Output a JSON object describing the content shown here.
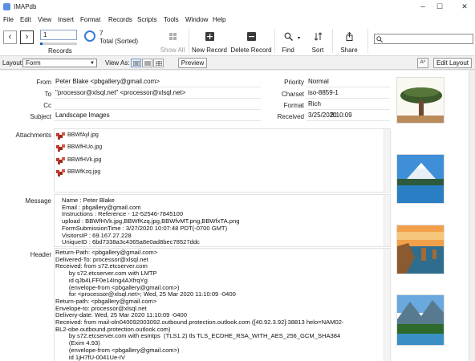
{
  "window": {
    "title": "IMAPdb",
    "minimize": "–",
    "maximize": "☐",
    "close": "✕"
  },
  "menu": [
    "File",
    "Edit",
    "View",
    "Insert",
    "Format",
    "Records",
    "Scripts",
    "Tools",
    "Window",
    "Help"
  ],
  "toolbar": {
    "record_number": "1",
    "records_label": "Records",
    "found_count": "7",
    "total_label": "Total (Sorted)",
    "show_all": "Show All",
    "new_record": "New Record",
    "delete_record": "Delete Record",
    "find": "Find",
    "sort": "Sort",
    "share": "Share",
    "search_placeholder": ""
  },
  "layoutbar": {
    "layout_label": "Layout:",
    "layout_value": "Form",
    "view_as": "View As:",
    "preview": "Preview",
    "aa": "Aᴬ",
    "edit_layout": "Edit Layout"
  },
  "record": {
    "labels": {
      "from": "From",
      "to": "To",
      "cc": "Cc",
      "subject": "Subject",
      "priority": "Priority",
      "charset": "Charset",
      "format": "Format",
      "received": "Received",
      "attachments": "Attachments",
      "message": "Message",
      "header": "Header"
    },
    "from": "Peter Blake <pbgallery@gmail.com>",
    "to": "\"processor@xlsql.net\" <processor@xlsql.net>",
    "cc": "",
    "subject": "Landscape Images",
    "priority": "Normal",
    "charset": "iso-8859-1",
    "format": "Rich",
    "received_date": "3/25/2020",
    "received_time": "8:10:09",
    "attachments": [
      "BBWfAyl.jpg",
      "BBWfHUo.jpg",
      "BBWfHVk.jpg",
      "BBWfKzq.jpg"
    ],
    "message": "Name : Peter Blake\nEmail : pbgallery@gmail.com\nInstructions : Reference - 12-52546-7845100\nupload : BBWfHVk.jpg,BBWfKzq.jpg,BBWfvMT.png,BBWfxTA.png\nFormSubmissionTime : 3/27/2020 10:07:48 PDT(-0700 GMT)\nVisitorsIP : 69.167.27.228\nUniqueID : 6bd7338a3c4365a8e0ad8bec78527ddc",
    "header": "Return-Path: <pbgallery@gmail.com>\nDelivered-To: processor@xlsql.net\nReceived: from s72.etcserver.com\n        by s72.etcserver.com with LMTP\n        id qJb4LFF0e14Ing4AXfrqYg\n        (envelope-from <pbgallery@gmail.com>)\n        for <processor@xlsql.net>; Wed, 25 Mar 2020 11:10:09 -0400\nReturn-path: <pbgallery@gmail.com>\nEnvelope-to: processor@xlsql.net\nDelivery-date: Wed, 25 Mar 2020 11:10:09 -0400\nReceived: from mail-oln040092003092.outbound.protection.outlook.com ([40.92.3.92]:38813 helo=NAM02-\nBL2-obe.outbound.protection.outlook.com)\n        by s72.etcserver.com with esmtps  (TLS1.2) tls TLS_ECDHE_RSA_WITH_AES_256_GCM_SHA384\n        (Exim 4.93)\n        (envelope-from <pbgallery@gmail.com>)\n        id 1jH7fU-0041Ue-IV"
  },
  "colors": {
    "accent": "#1c5fbf",
    "background": "#f0f0f0"
  }
}
